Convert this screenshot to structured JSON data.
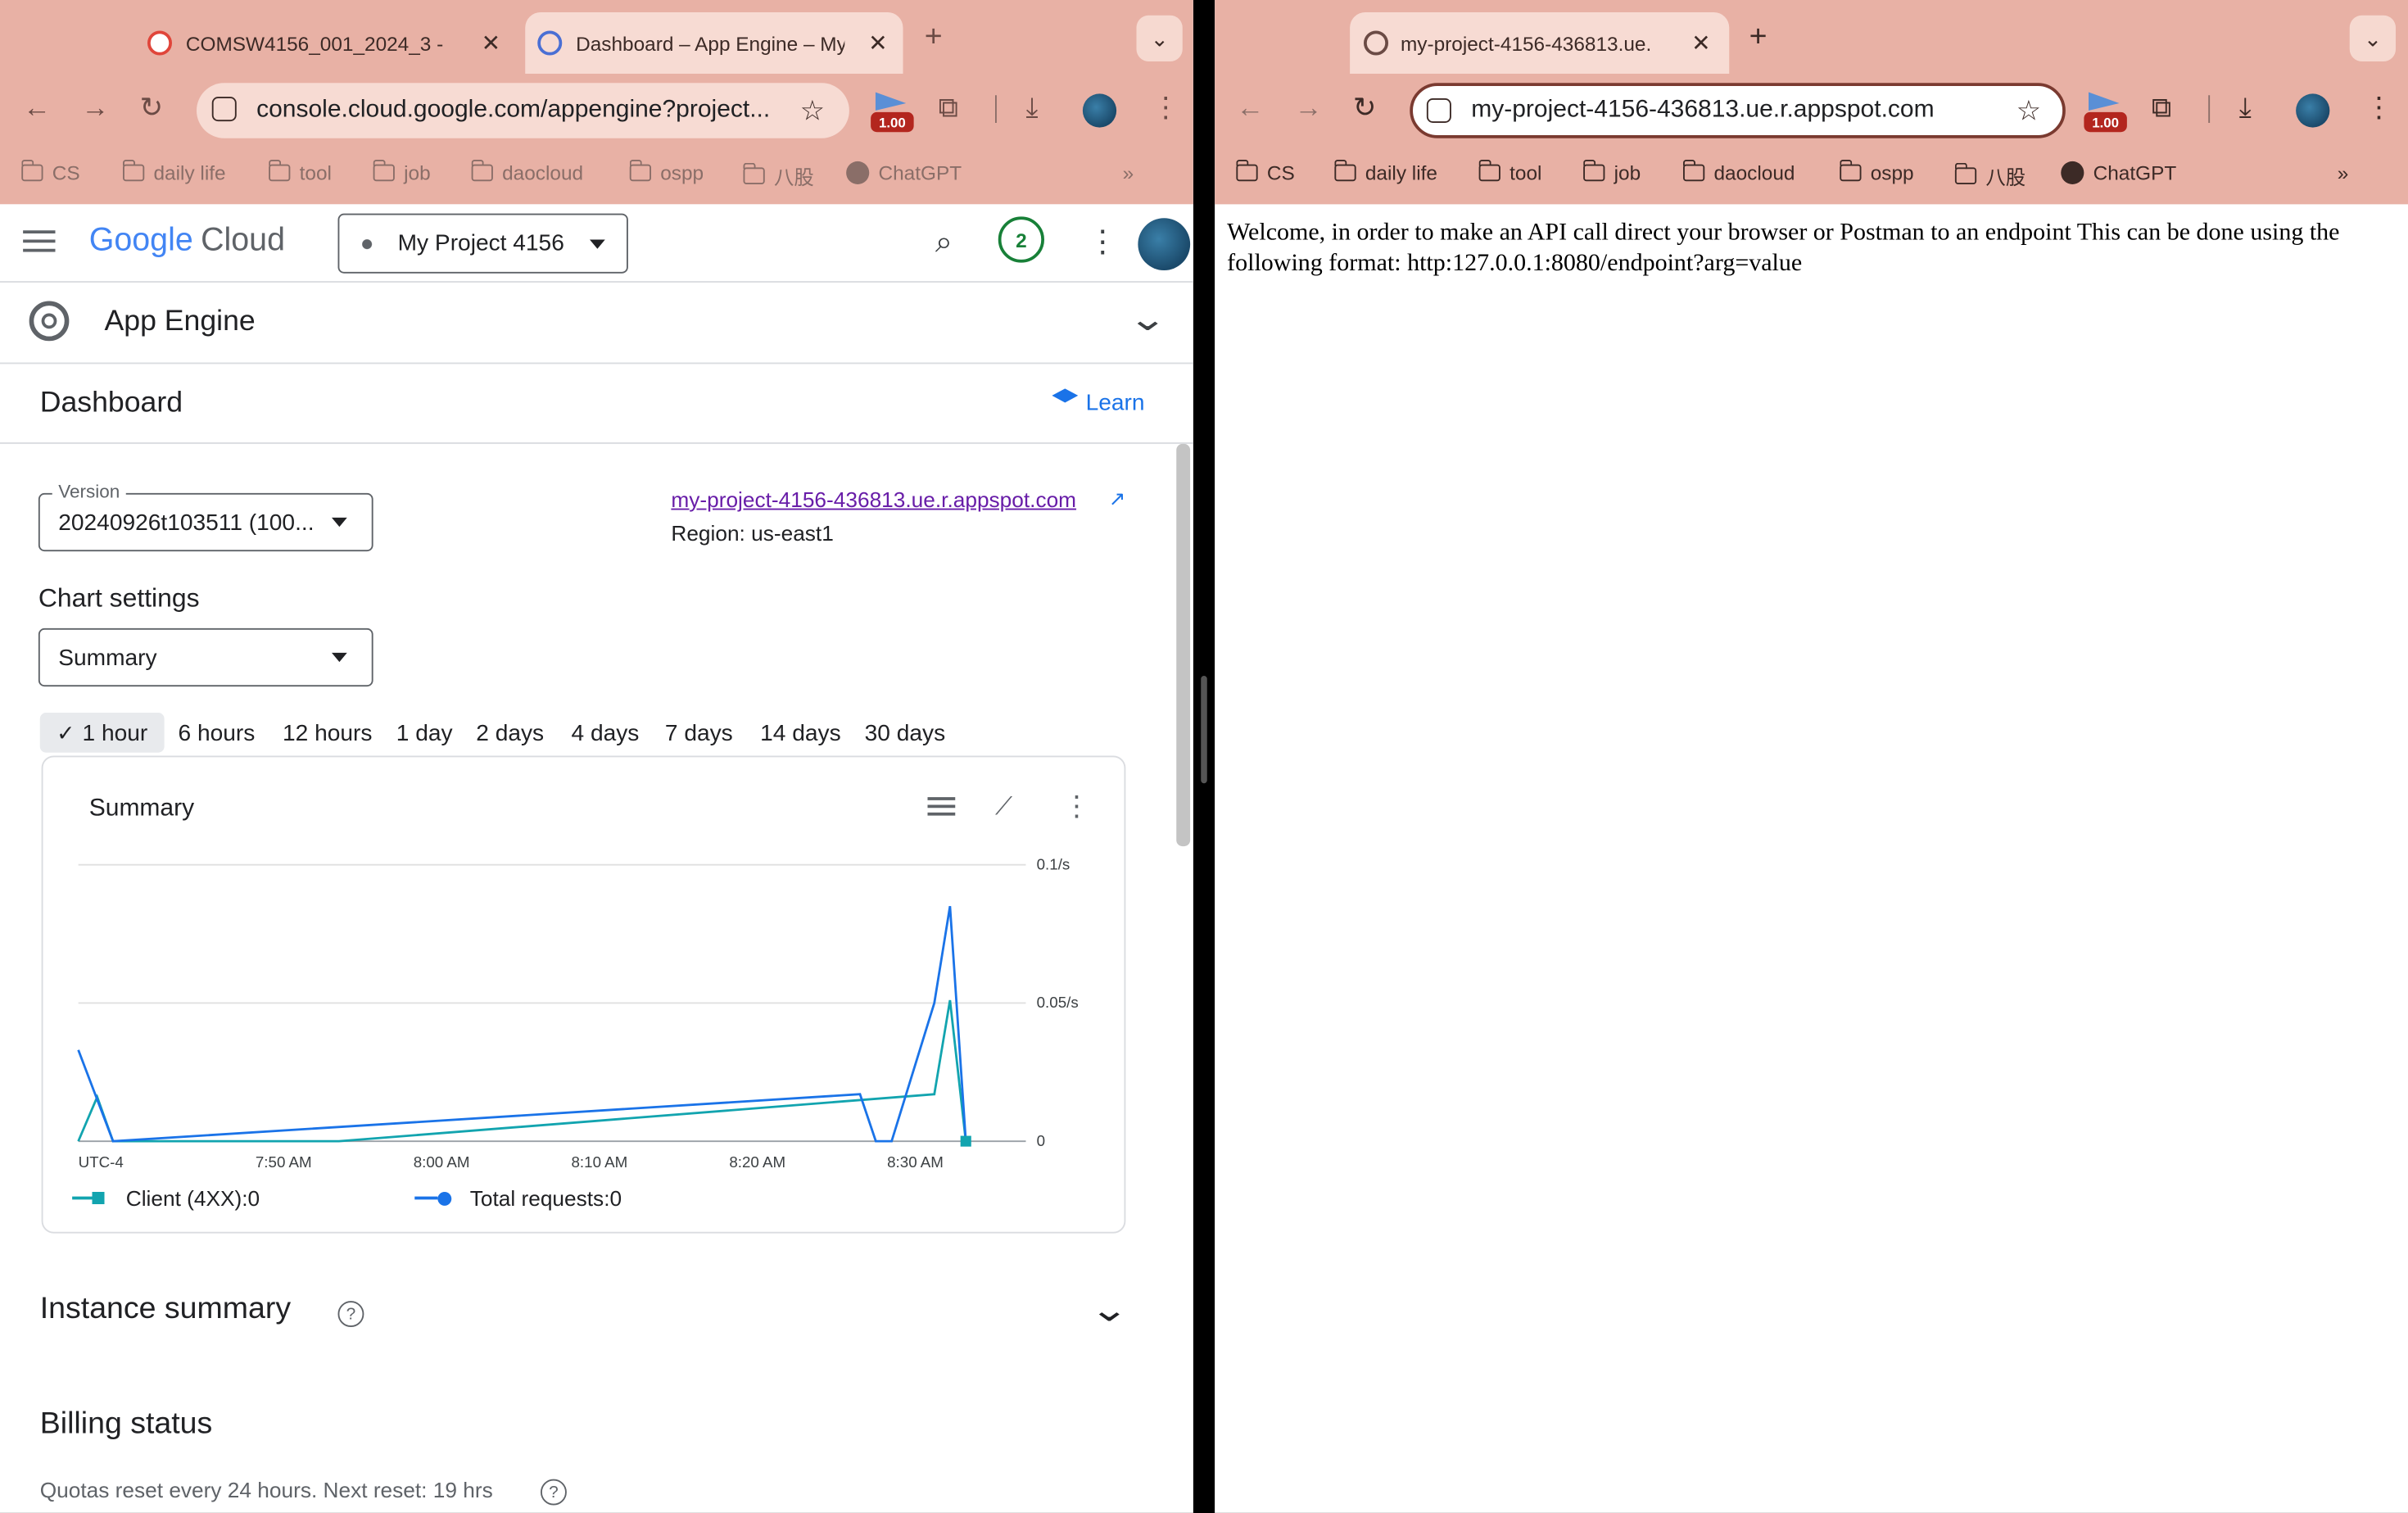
{
  "left_browser": {
    "tabs": [
      {
        "title": "COMSW4156_001_2024_3 -",
        "active": false
      },
      {
        "title": "Dashboard – App Engine – My",
        "active": true
      }
    ],
    "url": "console.cloud.google.com/appengine?project...",
    "ext_badge": "1.00",
    "bookmarks": [
      "CS",
      "daily life",
      "tool",
      "job",
      "daocloud",
      "ospp",
      "八股",
      "ChatGPT"
    ]
  },
  "console": {
    "logo_google": "Google",
    "logo_cloud": "Cloud",
    "project": "My Project 4156",
    "notifications": "2",
    "product": "App Engine",
    "page_title": "Dashboard",
    "learn": "Learn",
    "version_label": "Version",
    "version_value": "20240926t103511 (100...",
    "app_url": "my-project-4156-436813.ue.r.appspot.com",
    "region": "Region: us-east1",
    "chart_settings_label": "Chart settings",
    "chart_settings_value": "Summary",
    "time_ranges": [
      "1 hour",
      "6 hours",
      "12 hours",
      "1 day",
      "2 days",
      "4 days",
      "7 days",
      "14 days",
      "30 days"
    ],
    "selected_range": "1 hour",
    "card_title": "Summary",
    "instance_summary": "Instance summary",
    "billing_status": "Billing status",
    "quota_text": "Quotas reset every 24 hours. Next reset: 19 hrs"
  },
  "chart_data": {
    "type": "line",
    "title": "Summary",
    "y_ticks": [
      "0.1/s",
      "0.05/s",
      "0"
    ],
    "ylim": [
      0,
      0.1
    ],
    "x_ticks": [
      "UTC-4",
      "7:50 AM",
      "8:00 AM",
      "8:10 AM",
      "8:20 AM",
      "8:30 AM"
    ],
    "x_domain_minutes": [
      0,
      60
    ],
    "series": [
      {
        "name": "Client (4XX)",
        "legend_value": "0",
        "color": "#12a4af",
        "points": [
          [
            0,
            0
          ],
          [
            1.2,
            0.016
          ],
          [
            2.2,
            0
          ],
          [
            16.5,
            0
          ],
          [
            54.2,
            0.017
          ],
          [
            55.2,
            0.051
          ],
          [
            56.2,
            0
          ]
        ]
      },
      {
        "name": "Total requests",
        "legend_value": "0",
        "color": "#1a73e8",
        "points": [
          [
            0,
            0.033
          ],
          [
            2.2,
            0
          ],
          [
            49.5,
            0.017
          ],
          [
            50.5,
            0
          ],
          [
            51.5,
            0
          ],
          [
            54.2,
            0.05
          ],
          [
            55.2,
            0.085
          ],
          [
            56.2,
            0
          ]
        ]
      }
    ]
  },
  "right_browser": {
    "tab_title": "my-project-4156-436813.ue.",
    "url": "my-project-4156-436813.ue.r.appspot.com",
    "ext_badge": "1.00",
    "bookmarks": [
      "CS",
      "daily life",
      "tool",
      "job",
      "daocloud",
      "ospp",
      "八股",
      "ChatGPT"
    ],
    "page_text": "Welcome, in order to make an API call direct your browser or Postman to an endpoint This can be done using the following format: http:127.0.0.1:8080/endpoint?arg=value"
  }
}
